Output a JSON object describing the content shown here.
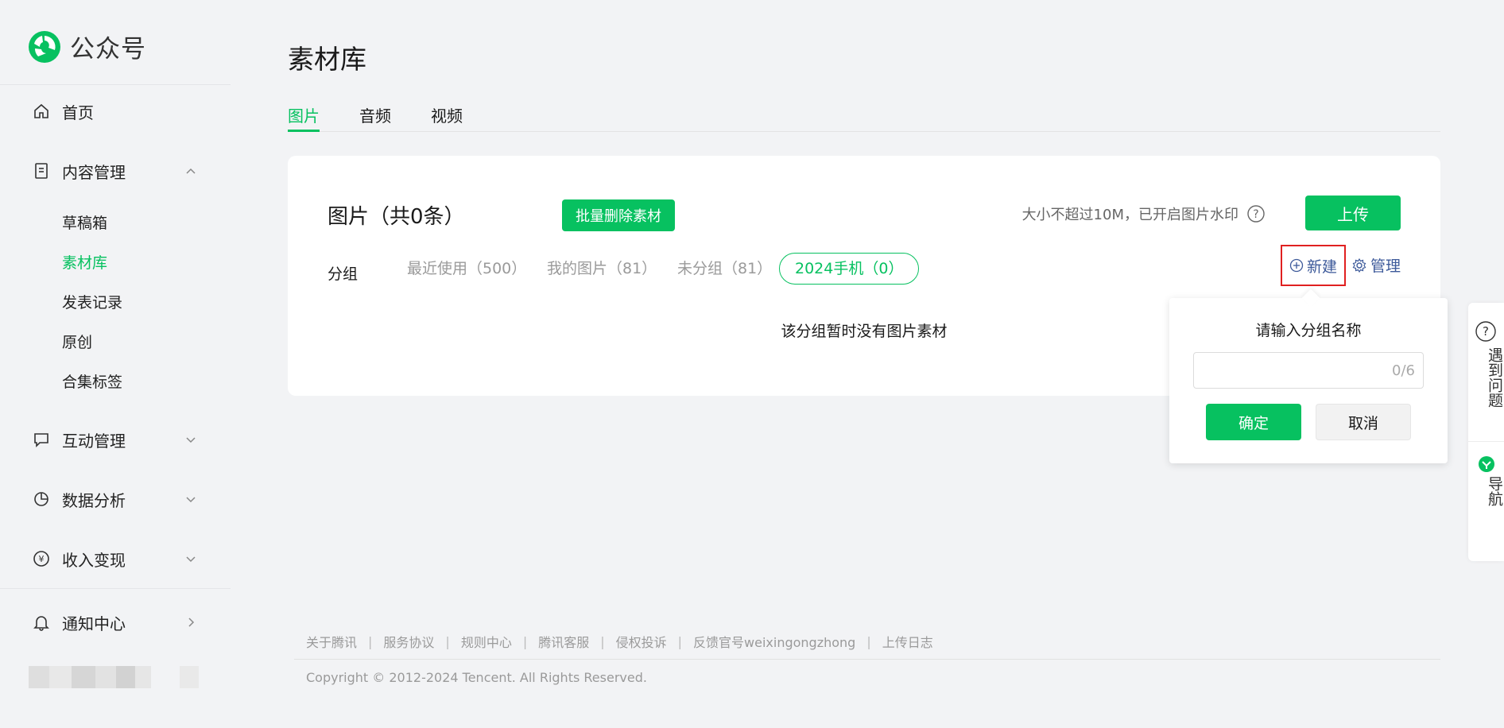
{
  "brand": {
    "name": "公众号",
    "color": "#07c160"
  },
  "sidebar": {
    "items": [
      {
        "label": "首页",
        "icon": "home-icon"
      },
      {
        "label": "内容管理",
        "icon": "document-icon",
        "expanded": true,
        "children": [
          {
            "label": "草稿箱"
          },
          {
            "label": "素材库",
            "active": true
          },
          {
            "label": "发表记录"
          },
          {
            "label": "原创"
          },
          {
            "label": "合集标签"
          }
        ]
      },
      {
        "label": "互动管理",
        "icon": "chat-icon"
      },
      {
        "label": "数据分析",
        "icon": "pie-chart-icon"
      },
      {
        "label": "收入变现",
        "icon": "yen-icon"
      },
      {
        "label": "通知中心",
        "icon": "bell-icon"
      }
    ]
  },
  "main": {
    "title": "素材库",
    "tabs": [
      {
        "label": "图片",
        "active": true
      },
      {
        "label": "音频"
      },
      {
        "label": "视频"
      }
    ],
    "card": {
      "title": "图片（共0条）",
      "batch_delete": "批量删除素材",
      "hint": "大小不超过10M，已开启图片水印",
      "upload": "上传",
      "group_label": "分组",
      "groups": [
        {
          "label": "最近使用（500）"
        },
        {
          "label": "我的图片（81）"
        },
        {
          "label": "未分组（81）"
        },
        {
          "label": "2024手机（0）",
          "selected": true
        }
      ],
      "new_group": "新建",
      "manage": "管理",
      "empty": "该分组暂时没有图片素材"
    }
  },
  "popover": {
    "title": "请输入分组名称",
    "input_value": "",
    "counter": "0/6",
    "confirm": "确定",
    "cancel": "取消"
  },
  "float_panel": {
    "help": "遇到问题",
    "nav": "导航"
  },
  "footer": {
    "links": [
      "关于腾讯",
      "服务协议",
      "规则中心",
      "腾讯客服",
      "侵权投诉",
      "反馈官号weixingongzhong",
      "上传日志"
    ],
    "copyright": "Copyright © 2012-2024 Tencent. All Rights Reserved."
  }
}
